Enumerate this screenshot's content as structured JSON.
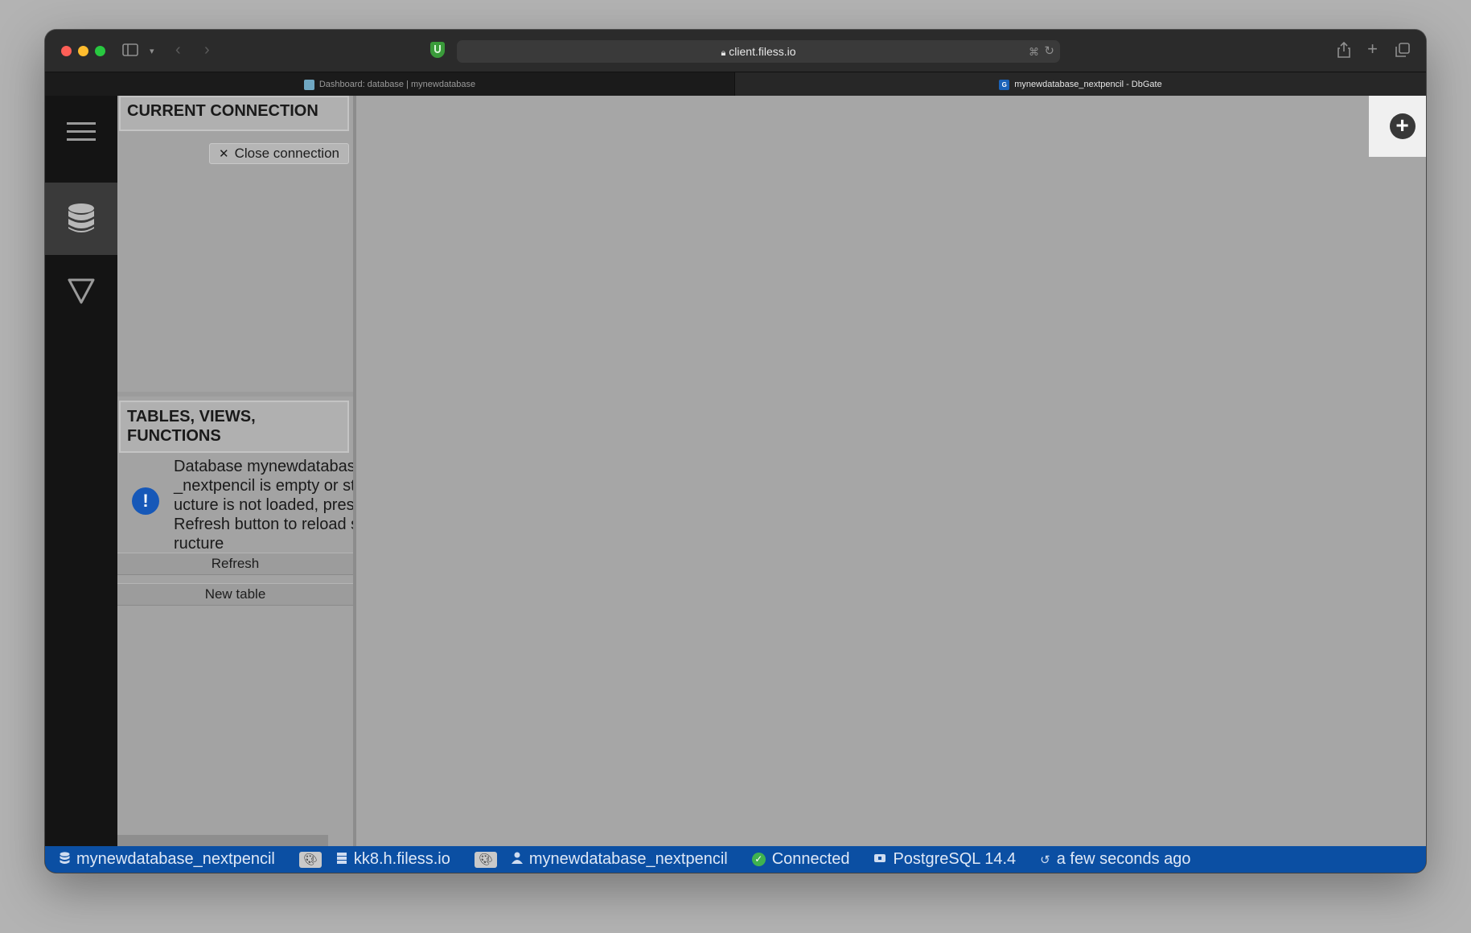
{
  "browser": {
    "url": "client.filess.io",
    "tabs": [
      {
        "title": "Dashboard: database | mynewdatabase",
        "active": false
      },
      {
        "title": "mynewdatabase_nextpencil - DbGate",
        "active": true
      }
    ]
  },
  "sidebar": {
    "icons": [
      "menu-icon",
      "database-icon",
      "filter-icon"
    ]
  },
  "panel": {
    "current_connection_title": "CURRENT CONNECTION",
    "close_connection_label": "Close connection",
    "tables_title": "TABLES, VIEWS, FUNCTIONS",
    "empty_message": "Database mynewdatabase_nextpencil is empty or structure is not loaded, press Refresh button to reload structure",
    "refresh_label": "Refresh",
    "new_table_label": "New table"
  },
  "statusbar": {
    "database": "mynewdatabase_nextpencil",
    "host": "kk8.h.filess.io",
    "user": "mynewdatabase_nextpencil",
    "status": "Connected",
    "engine": "PostgreSQL 14.4",
    "refreshed": "a few seconds ago"
  },
  "colors": {
    "statusbar_bg": "#0b4fa3",
    "connected": "#3fb24f",
    "info_icon": "#1658b8"
  }
}
